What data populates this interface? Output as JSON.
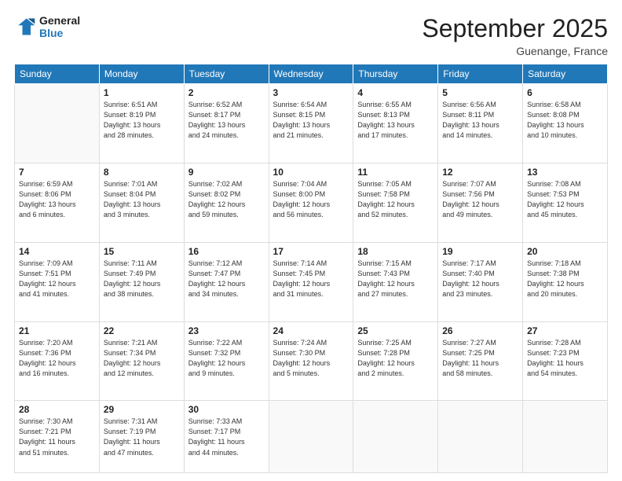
{
  "logo": {
    "line1": "General",
    "line2": "Blue"
  },
  "title": "September 2025",
  "location": "Guenange, France",
  "weekdays": [
    "Sunday",
    "Monday",
    "Tuesday",
    "Wednesday",
    "Thursday",
    "Friday",
    "Saturday"
  ],
  "weeks": [
    [
      {
        "day": "",
        "info": ""
      },
      {
        "day": "1",
        "info": "Sunrise: 6:51 AM\nSunset: 8:19 PM\nDaylight: 13 hours\nand 28 minutes."
      },
      {
        "day": "2",
        "info": "Sunrise: 6:52 AM\nSunset: 8:17 PM\nDaylight: 13 hours\nand 24 minutes."
      },
      {
        "day": "3",
        "info": "Sunrise: 6:54 AM\nSunset: 8:15 PM\nDaylight: 13 hours\nand 21 minutes."
      },
      {
        "day": "4",
        "info": "Sunrise: 6:55 AM\nSunset: 8:13 PM\nDaylight: 13 hours\nand 17 minutes."
      },
      {
        "day": "5",
        "info": "Sunrise: 6:56 AM\nSunset: 8:11 PM\nDaylight: 13 hours\nand 14 minutes."
      },
      {
        "day": "6",
        "info": "Sunrise: 6:58 AM\nSunset: 8:08 PM\nDaylight: 13 hours\nand 10 minutes."
      }
    ],
    [
      {
        "day": "7",
        "info": "Sunrise: 6:59 AM\nSunset: 8:06 PM\nDaylight: 13 hours\nand 6 minutes."
      },
      {
        "day": "8",
        "info": "Sunrise: 7:01 AM\nSunset: 8:04 PM\nDaylight: 13 hours\nand 3 minutes."
      },
      {
        "day": "9",
        "info": "Sunrise: 7:02 AM\nSunset: 8:02 PM\nDaylight: 12 hours\nand 59 minutes."
      },
      {
        "day": "10",
        "info": "Sunrise: 7:04 AM\nSunset: 8:00 PM\nDaylight: 12 hours\nand 56 minutes."
      },
      {
        "day": "11",
        "info": "Sunrise: 7:05 AM\nSunset: 7:58 PM\nDaylight: 12 hours\nand 52 minutes."
      },
      {
        "day": "12",
        "info": "Sunrise: 7:07 AM\nSunset: 7:56 PM\nDaylight: 12 hours\nand 49 minutes."
      },
      {
        "day": "13",
        "info": "Sunrise: 7:08 AM\nSunset: 7:53 PM\nDaylight: 12 hours\nand 45 minutes."
      }
    ],
    [
      {
        "day": "14",
        "info": "Sunrise: 7:09 AM\nSunset: 7:51 PM\nDaylight: 12 hours\nand 41 minutes."
      },
      {
        "day": "15",
        "info": "Sunrise: 7:11 AM\nSunset: 7:49 PM\nDaylight: 12 hours\nand 38 minutes."
      },
      {
        "day": "16",
        "info": "Sunrise: 7:12 AM\nSunset: 7:47 PM\nDaylight: 12 hours\nand 34 minutes."
      },
      {
        "day": "17",
        "info": "Sunrise: 7:14 AM\nSunset: 7:45 PM\nDaylight: 12 hours\nand 31 minutes."
      },
      {
        "day": "18",
        "info": "Sunrise: 7:15 AM\nSunset: 7:43 PM\nDaylight: 12 hours\nand 27 minutes."
      },
      {
        "day": "19",
        "info": "Sunrise: 7:17 AM\nSunset: 7:40 PM\nDaylight: 12 hours\nand 23 minutes."
      },
      {
        "day": "20",
        "info": "Sunrise: 7:18 AM\nSunset: 7:38 PM\nDaylight: 12 hours\nand 20 minutes."
      }
    ],
    [
      {
        "day": "21",
        "info": "Sunrise: 7:20 AM\nSunset: 7:36 PM\nDaylight: 12 hours\nand 16 minutes."
      },
      {
        "day": "22",
        "info": "Sunrise: 7:21 AM\nSunset: 7:34 PM\nDaylight: 12 hours\nand 12 minutes."
      },
      {
        "day": "23",
        "info": "Sunrise: 7:22 AM\nSunset: 7:32 PM\nDaylight: 12 hours\nand 9 minutes."
      },
      {
        "day": "24",
        "info": "Sunrise: 7:24 AM\nSunset: 7:30 PM\nDaylight: 12 hours\nand 5 minutes."
      },
      {
        "day": "25",
        "info": "Sunrise: 7:25 AM\nSunset: 7:28 PM\nDaylight: 12 hours\nand 2 minutes."
      },
      {
        "day": "26",
        "info": "Sunrise: 7:27 AM\nSunset: 7:25 PM\nDaylight: 11 hours\nand 58 minutes."
      },
      {
        "day": "27",
        "info": "Sunrise: 7:28 AM\nSunset: 7:23 PM\nDaylight: 11 hours\nand 54 minutes."
      }
    ],
    [
      {
        "day": "28",
        "info": "Sunrise: 7:30 AM\nSunset: 7:21 PM\nDaylight: 11 hours\nand 51 minutes."
      },
      {
        "day": "29",
        "info": "Sunrise: 7:31 AM\nSunset: 7:19 PM\nDaylight: 11 hours\nand 47 minutes."
      },
      {
        "day": "30",
        "info": "Sunrise: 7:33 AM\nSunset: 7:17 PM\nDaylight: 11 hours\nand 44 minutes."
      },
      {
        "day": "",
        "info": ""
      },
      {
        "day": "",
        "info": ""
      },
      {
        "day": "",
        "info": ""
      },
      {
        "day": "",
        "info": ""
      }
    ]
  ]
}
